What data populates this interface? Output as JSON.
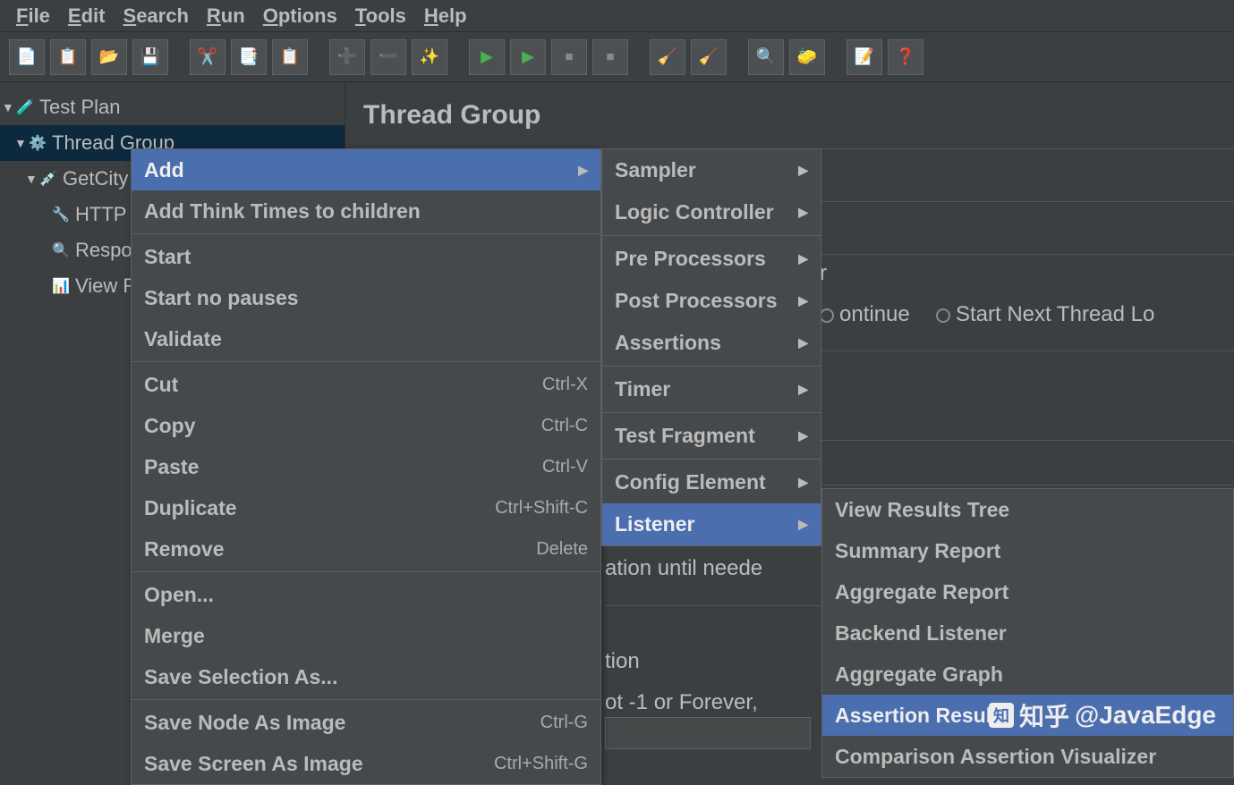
{
  "menubar": [
    "File",
    "Edit",
    "Search",
    "Run",
    "Options",
    "Tools",
    "Help"
  ],
  "tree": {
    "test_plan": "Test Plan",
    "thread_group": "Thread Group",
    "get_city": "GetCity",
    "http": "HTTP",
    "respo": "Respo",
    "view_r": "View R"
  },
  "panel": {
    "title": "Thread Group",
    "text_r": "r",
    "text_continue": "ontinue",
    "text_start_next": "Start Next Thread Lo",
    "text_ation": "ation until neede",
    "text_tion": "tion",
    "text_ot": "ot -1 or Forever,"
  },
  "context_menu": [
    {
      "label": "Add",
      "shortcut": "",
      "submenu": true,
      "highlight": true
    },
    {
      "label": "Add Think Times to children",
      "shortcut": ""
    },
    {
      "sep": true
    },
    {
      "label": "Start",
      "shortcut": ""
    },
    {
      "label": "Start no pauses",
      "shortcut": ""
    },
    {
      "label": "Validate",
      "shortcut": ""
    },
    {
      "sep": true
    },
    {
      "label": "Cut",
      "shortcut": "Ctrl-X"
    },
    {
      "label": "Copy",
      "shortcut": "Ctrl-C"
    },
    {
      "label": "Paste",
      "shortcut": "Ctrl-V"
    },
    {
      "label": "Duplicate",
      "shortcut": "Ctrl+Shift-C"
    },
    {
      "label": "Remove",
      "shortcut": "Delete"
    },
    {
      "sep": true
    },
    {
      "label": "Open...",
      "shortcut": ""
    },
    {
      "label": "Merge",
      "shortcut": ""
    },
    {
      "label": "Save Selection As...",
      "shortcut": ""
    },
    {
      "sep": true
    },
    {
      "label": "Save Node As Image",
      "shortcut": "Ctrl-G"
    },
    {
      "label": "Save Screen As Image",
      "shortcut": "Ctrl+Shift-G"
    }
  ],
  "add_submenu": [
    {
      "label": "Sampler"
    },
    {
      "label": "Logic Controller"
    },
    {
      "sep": true
    },
    {
      "label": "Pre Processors"
    },
    {
      "label": "Post Processors"
    },
    {
      "label": "Assertions"
    },
    {
      "sep": true
    },
    {
      "label": "Timer"
    },
    {
      "sep": true
    },
    {
      "label": "Test Fragment"
    },
    {
      "sep": true
    },
    {
      "label": "Config Element"
    },
    {
      "label": "Listener",
      "highlight": true
    }
  ],
  "listener_submenu": [
    {
      "label": "View Results Tree"
    },
    {
      "label": "Summary Report"
    },
    {
      "label": "Aggregate Report"
    },
    {
      "label": "Backend Listener"
    },
    {
      "label": "Aggregate Graph"
    },
    {
      "label": "Assertion Results",
      "highlight": true
    },
    {
      "label": "Comparison Assertion Visualizer"
    }
  ],
  "watermark": "@JavaEdge",
  "watermark_brand": "知乎"
}
